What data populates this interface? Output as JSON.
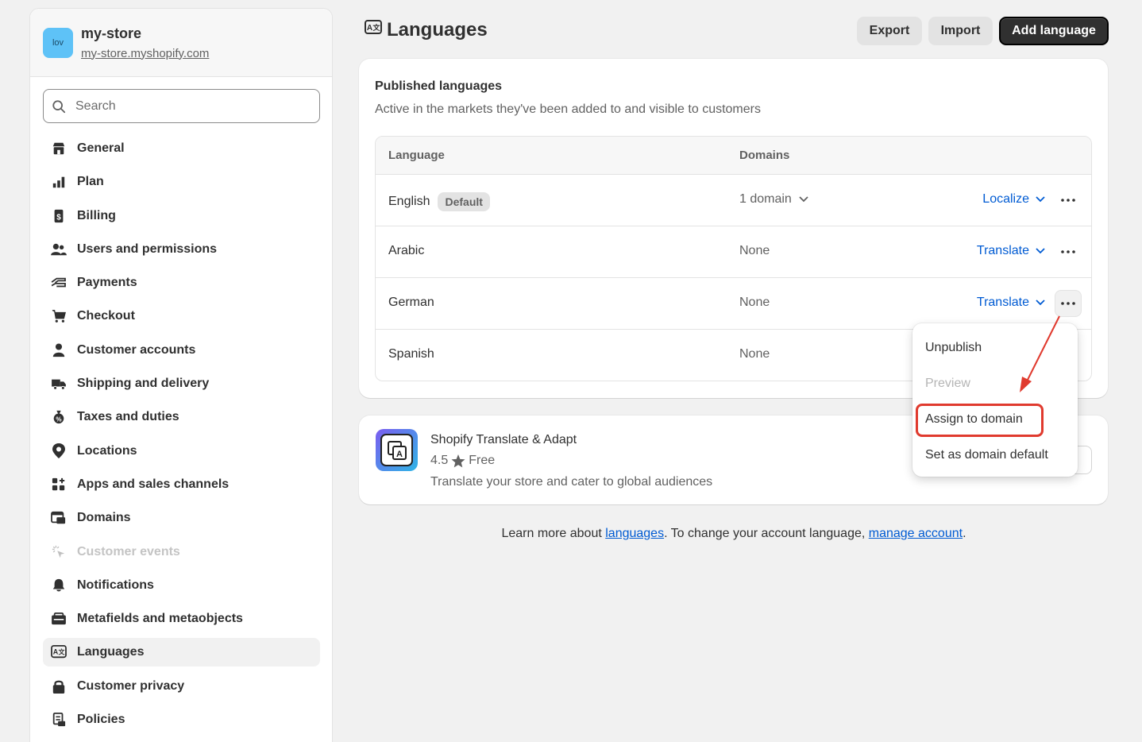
{
  "store": {
    "avatar_text": "lov",
    "name": "my-store",
    "url": "my-store.myshopify.com"
  },
  "search": {
    "placeholder": "Search"
  },
  "nav": [
    {
      "label": "General",
      "icon": "store-icon"
    },
    {
      "label": "Plan",
      "icon": "plan-icon"
    },
    {
      "label": "Billing",
      "icon": "billing-icon"
    },
    {
      "label": "Users and permissions",
      "icon": "users-icon"
    },
    {
      "label": "Payments",
      "icon": "payments-icon"
    },
    {
      "label": "Checkout",
      "icon": "cart-icon"
    },
    {
      "label": "Customer accounts",
      "icon": "person-icon"
    },
    {
      "label": "Shipping and delivery",
      "icon": "truck-icon"
    },
    {
      "label": "Taxes and duties",
      "icon": "tax-icon"
    },
    {
      "label": "Locations",
      "icon": "location-icon"
    },
    {
      "label": "Apps and sales channels",
      "icon": "apps-icon"
    },
    {
      "label": "Domains",
      "icon": "domains-icon"
    },
    {
      "label": "Customer events",
      "icon": "events-icon"
    },
    {
      "label": "Notifications",
      "icon": "bell-icon"
    },
    {
      "label": "Metafields and metaobjects",
      "icon": "metafields-icon"
    },
    {
      "label": "Languages",
      "icon": "languages-icon"
    },
    {
      "label": "Customer privacy",
      "icon": "lock-icon"
    },
    {
      "label": "Policies",
      "icon": "policies-icon"
    }
  ],
  "header": {
    "title": "Languages",
    "export_label": "Export",
    "import_label": "Import",
    "add_label": "Add language"
  },
  "published": {
    "title": "Published languages",
    "subtitle": "Active in the markets they've been added to and visible to customers",
    "col_language": "Language",
    "col_domains": "Domains",
    "rows": [
      {
        "language": "English",
        "badge": "Default",
        "domains": "1 domain",
        "action": "Localize"
      },
      {
        "language": "Arabic",
        "domains": "None",
        "action": "Translate"
      },
      {
        "language": "German",
        "domains": "None",
        "action": "Translate"
      },
      {
        "language": "Spanish",
        "domains": "None"
      }
    ]
  },
  "app": {
    "name": "Shopify Translate & Adapt",
    "rating": "4.5",
    "price": "Free",
    "description": "Translate your store and cater to global audiences"
  },
  "footer": {
    "text1": "Learn more about ",
    "link1": "languages",
    "text2": ". To change your account language, ",
    "link2": "manage account",
    "text3": "."
  },
  "menu": {
    "unpublish": "Unpublish",
    "preview": "Preview",
    "assign": "Assign to domain",
    "set_default": "Set as domain default"
  },
  "colors": {
    "link": "#005bd3",
    "annotation": "#e03a2e",
    "primary_button": "#303030"
  }
}
